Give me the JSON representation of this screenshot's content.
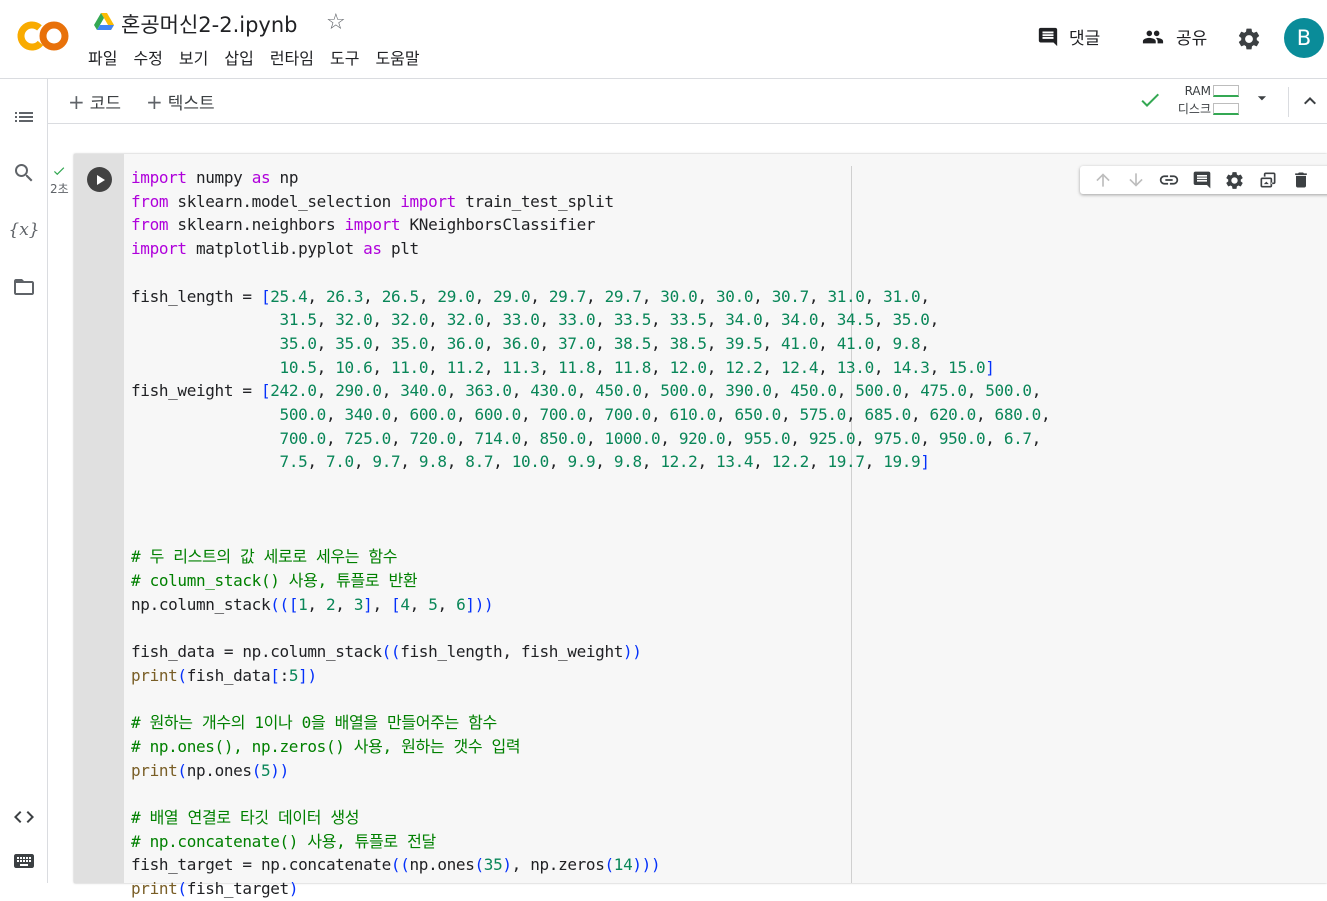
{
  "app": {
    "logo_text": "CO",
    "file_name": "혼공머신2-2.ipynb",
    "avatar_letter": "B"
  },
  "menu": [
    "파일",
    "수정",
    "보기",
    "삽입",
    "런타임",
    "도구",
    "도움말"
  ],
  "header_actions": {
    "comment_label": "댓글",
    "share_label": "공유"
  },
  "toolbar": {
    "add_code": "코드",
    "add_text": "텍스트",
    "ram_label": "RAM",
    "disk_label": "디스크"
  },
  "cell": {
    "exec_time": "2초"
  },
  "colors": {
    "logo_orange": "#f9ab00",
    "keyword": "#af00db",
    "number": "#098658",
    "comment": "#008000",
    "function": "#795e26",
    "bracket": "#0431fa",
    "avatar": "#0a8c99",
    "check_green": "#34a853"
  },
  "icons": {
    "drive": "google-drive-icon",
    "star": "star-outline-icon",
    "comment": "comment-icon",
    "share": "people-icon",
    "settings": "gear-icon",
    "toc": "list-icon",
    "search": "search-icon",
    "variables": "variables-icon",
    "files": "folder-icon",
    "snippets": "code-icon",
    "terminal": "keyboard-icon"
  }
}
